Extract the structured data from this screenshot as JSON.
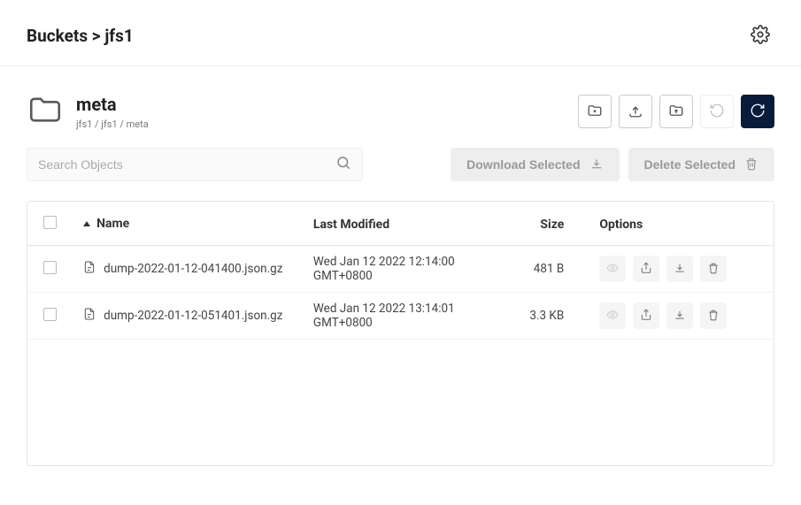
{
  "breadcrumb": "Buckets > jfs1",
  "folder": {
    "title": "meta",
    "path": "jfs1 / jfs1 / meta"
  },
  "search": {
    "placeholder": "Search Objects"
  },
  "bulk": {
    "download": "Download Selected",
    "delete": "Delete Selected"
  },
  "columns": {
    "name": "Name",
    "modified": "Last Modified",
    "size": "Size",
    "options": "Options"
  },
  "rows": [
    {
      "name": "dump-2022-01-12-041400.json.gz",
      "modified": "Wed Jan 12 2022 12:14:00 GMT+0800",
      "size": "481 B"
    },
    {
      "name": "dump-2022-01-12-051401.json.gz",
      "modified": "Wed Jan 12 2022 13:14:01 GMT+0800",
      "size": "3.3 KB"
    }
  ]
}
